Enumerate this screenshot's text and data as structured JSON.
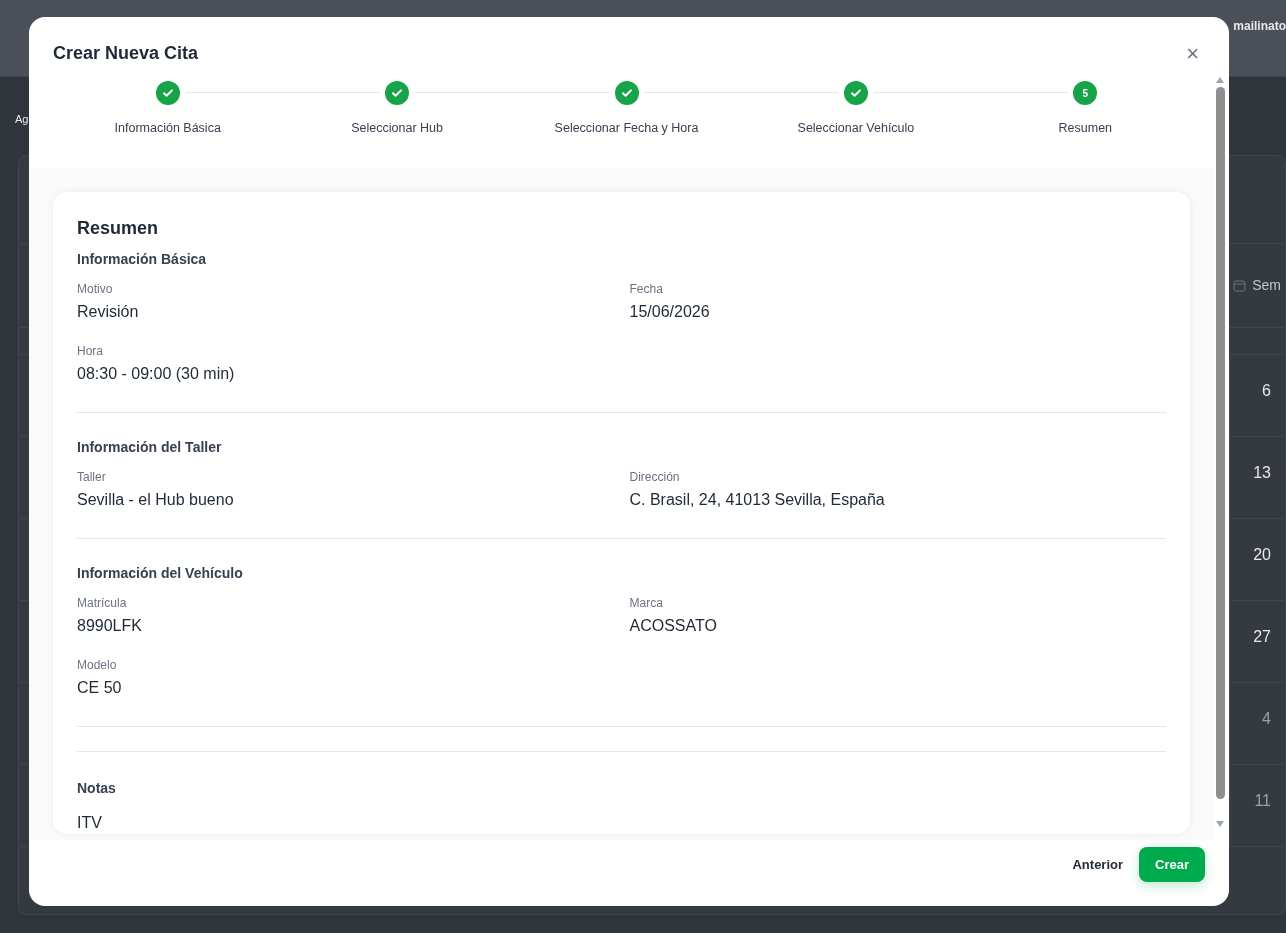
{
  "background": {
    "header_text": "mailinato",
    "page_text": "Ag",
    "calendar_header": "Sem",
    "weeks": [
      {
        "day": "6",
        "other_month": false
      },
      {
        "day": "13",
        "other_month": false
      },
      {
        "day": "20",
        "other_month": false
      },
      {
        "day": "27",
        "other_month": false
      },
      {
        "day": "4",
        "other_month": true
      },
      {
        "day": "11",
        "other_month": true
      }
    ]
  },
  "modal": {
    "title": "Crear Nueva Cita",
    "close": "×",
    "steps": [
      {
        "label": "Información Básica",
        "completed": true
      },
      {
        "label": "Seleccionar Hub",
        "completed": true
      },
      {
        "label": "Seleccionar Fecha y Hora",
        "completed": true
      },
      {
        "label": "Seleccionar Vehículo",
        "completed": true
      },
      {
        "label": "Resumen",
        "completed": false,
        "number": "5"
      }
    ],
    "summary": {
      "title": "Resumen",
      "sections": [
        {
          "title": "Información Básica",
          "fields": [
            {
              "label": "Motivo",
              "value": "Revisión"
            },
            {
              "label": "Fecha",
              "value": "15/06/2026"
            },
            {
              "label": "Hora",
              "value": "08:30 - 09:00 (30 min)"
            }
          ]
        },
        {
          "title": "Información del Taller",
          "fields": [
            {
              "label": "Taller",
              "value": "Sevilla - el Hub bueno"
            },
            {
              "label": "Dirección",
              "value": "C. Brasil, 24, 41013 Sevilla, España"
            }
          ]
        },
        {
          "title": "Información del Vehículo",
          "fields": [
            {
              "label": "Matrícula",
              "value": "8990LFK"
            },
            {
              "label": "Marca",
              "value": "ACOSSATO"
            },
            {
              "label": "Modelo",
              "value": "CE 50"
            }
          ]
        }
      ],
      "notes": {
        "title": "Notas",
        "value": "ITV"
      }
    },
    "buttons": [
      {
        "label": "Anterior",
        "kind": "link"
      },
      {
        "label": "Crear",
        "kind": "primary"
      }
    ]
  }
}
